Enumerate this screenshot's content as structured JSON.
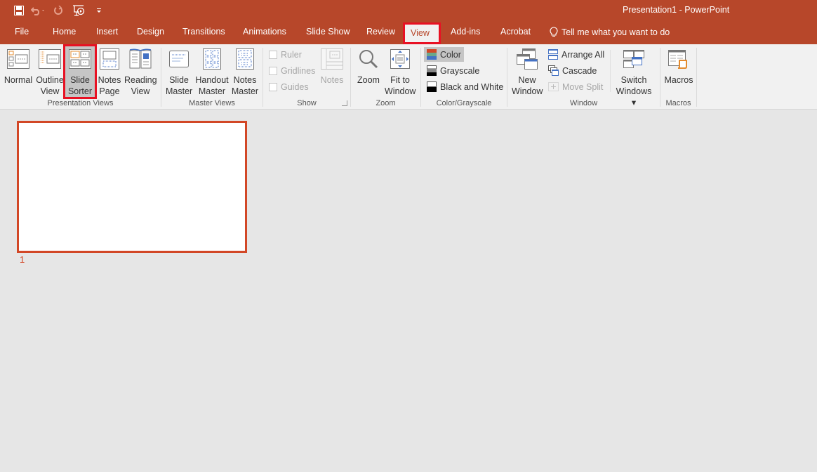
{
  "window": {
    "title": "Presentation1 - PowerPoint"
  },
  "quick_access": [
    {
      "name": "save-icon",
      "enabled": true
    },
    {
      "name": "undo-icon",
      "enabled": false
    },
    {
      "name": "redo-icon",
      "enabled": false
    },
    {
      "name": "start-from-beginning-icon",
      "enabled": true
    },
    {
      "name": "customize-qat-icon",
      "enabled": true
    }
  ],
  "tabs": [
    {
      "label": "File"
    },
    {
      "label": "Home"
    },
    {
      "label": "Insert"
    },
    {
      "label": "Design"
    },
    {
      "label": "Transitions"
    },
    {
      "label": "Animations"
    },
    {
      "label": "Slide Show"
    },
    {
      "label": "Review"
    },
    {
      "label": "View",
      "active": true
    },
    {
      "label": "Add-ins"
    },
    {
      "label": "Acrobat"
    }
  ],
  "tell_me": {
    "placeholder": "Tell me what you want to do"
  },
  "ribbon": {
    "presentation_views": {
      "label": "Presentation Views",
      "normal": {
        "line1": "Normal",
        "line2": ""
      },
      "outline": {
        "line1": "Outline",
        "line2": "View"
      },
      "slide_sorter": {
        "line1": "Slide",
        "line2": "Sorter",
        "selected": true
      },
      "notes_page": {
        "line1": "Notes",
        "line2": "Page"
      },
      "reading_view": {
        "line1": "Reading",
        "line2": "View"
      }
    },
    "master_views": {
      "label": "Master Views",
      "slide_master": {
        "line1": "Slide",
        "line2": "Master"
      },
      "handout_master": {
        "line1": "Handout",
        "line2": "Master"
      },
      "notes_master": {
        "line1": "Notes",
        "line2": "Master"
      }
    },
    "show": {
      "label": "Show",
      "ruler": "Ruler",
      "gridlines": "Gridlines",
      "guides": "Guides",
      "notes": "Notes"
    },
    "zoom": {
      "label": "Zoom",
      "zoom": {
        "line1": "Zoom",
        "line2": ""
      },
      "fit": {
        "line1": "Fit to",
        "line2": "Window"
      }
    },
    "color": {
      "label": "Color/Grayscale",
      "color": "Color",
      "grayscale": "Grayscale",
      "bw": "Black and White",
      "selected": "Color"
    },
    "window": {
      "label": "Window",
      "new_window": {
        "line1": "New",
        "line2": "Window"
      },
      "arrange_all": "Arrange All",
      "cascade": "Cascade",
      "move_split": "Move Split",
      "switch_windows": {
        "line1": "Switch",
        "line2": "Windows ▾"
      }
    },
    "macros": {
      "label": "Macros",
      "macros": {
        "line1": "Macros",
        "line2": ""
      }
    }
  },
  "slides": [
    {
      "number": "1",
      "selected": true
    }
  ],
  "colors": {
    "accent": "#b7472a",
    "highlight": "#e81123",
    "slide_border": "#d24726"
  }
}
